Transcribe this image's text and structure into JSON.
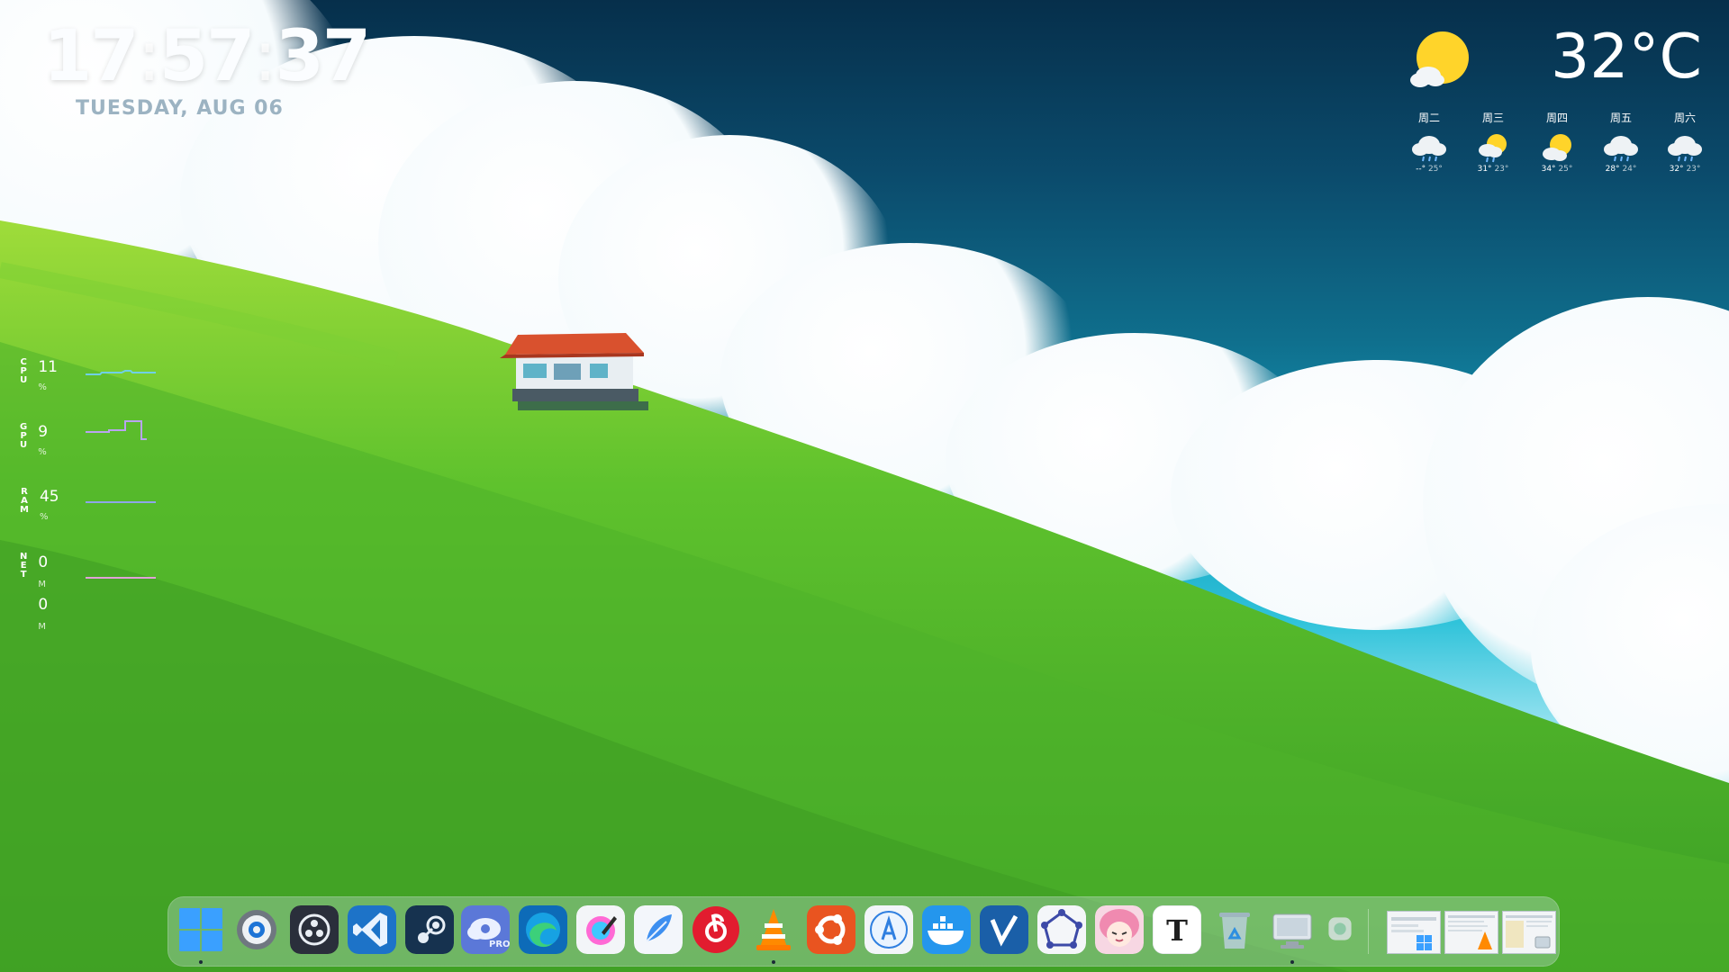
{
  "clock": {
    "hours": "17",
    "minutes": "57",
    "seconds": "37",
    "sep": ":",
    "date": "TUESDAY, AUG 06"
  },
  "weather": {
    "current_temp": "32°C",
    "current_icon": "sun-cloud-icon",
    "forecast": [
      {
        "day": "周二",
        "icon": "cloud-rain-icon",
        "hi": "--°",
        "lo": "25°"
      },
      {
        "day": "周三",
        "icon": "sun-cloud-rain-icon",
        "hi": "31°",
        "lo": "23°"
      },
      {
        "day": "周四",
        "icon": "sun-cloud-icon",
        "hi": "34°",
        "lo": "25°"
      },
      {
        "day": "周五",
        "icon": "cloud-rain-icon",
        "hi": "28°",
        "lo": "24°"
      },
      {
        "day": "周六",
        "icon": "cloud-rain-icon",
        "hi": "32°",
        "lo": "23°"
      }
    ]
  },
  "monitor": {
    "cpu": {
      "label": "CPU",
      "value": "11",
      "unit": "%",
      "color": "#6fd0e6"
    },
    "gpu": {
      "label": "GPU",
      "value": "9",
      "unit": "%",
      "color": "#b9a4f0"
    },
    "ram": {
      "label": "RAM",
      "value": "45",
      "unit": "%",
      "color": "#8ea6e8"
    },
    "net": {
      "label": "NET",
      "up": "0",
      "down": "0",
      "unit": "M",
      "color": "#e0a2d8"
    }
  },
  "dock": {
    "apps": [
      "windows-start-icon",
      "settings-icon",
      "obs-icon",
      "vscode-icon",
      "steam-icon",
      "cloud-pro-icon",
      "edge-icon",
      "color-picker-icon",
      "feather-icon",
      "netease-music-icon",
      "vlc-icon",
      "ubuntu-icon",
      "app-store-icon",
      "docker-icon",
      "v-app-icon",
      "polygon-app-icon",
      "anime-avatar-icon",
      "typora-icon",
      "recycle-bin-icon",
      "computer-icon",
      "small-widget-icon"
    ],
    "thumbnails": [
      "explorer-window-thumb",
      "vlc-window-thumb",
      "file-window-thumb"
    ]
  }
}
